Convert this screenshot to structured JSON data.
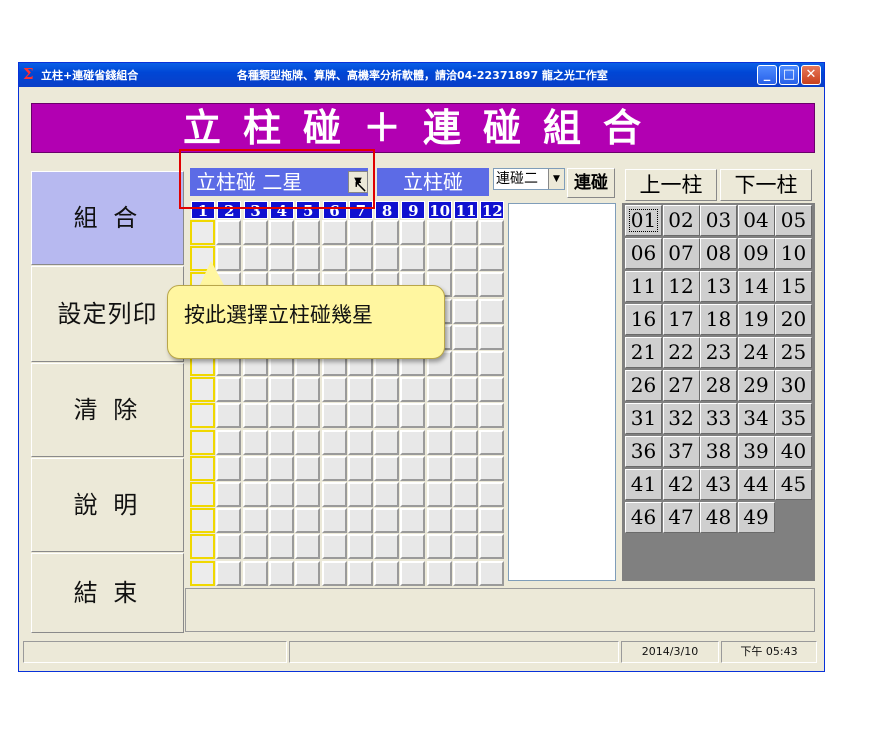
{
  "window": {
    "title": "立柱+連碰省錢組合",
    "subtitle": "各種類型拖牌、算牌、高機率分析軟體，請洽04-22371897 龍之光工作室",
    "minimize_icon": "minimize-icon",
    "maximize_icon": "maximize-icon",
    "close_icon": "close-icon"
  },
  "banner": {
    "title": "立柱碰＋連碰組合"
  },
  "sidebar": {
    "items": [
      {
        "label": "組 合"
      },
      {
        "label": "設定列印"
      },
      {
        "label": "清 除"
      },
      {
        "label": "說 明"
      },
      {
        "label": "結 束"
      }
    ]
  },
  "controls": {
    "star_select": "立柱碰  二星",
    "mode_label": "立柱碰",
    "connect_select": "連碰二",
    "connect_button": "連碰"
  },
  "grid": {
    "columns": [
      "1",
      "2",
      "3",
      "4",
      "5",
      "6",
      "7",
      "8",
      "9",
      "10",
      "11",
      "12"
    ],
    "rows": 14
  },
  "nav": {
    "prev": "上一柱",
    "next": "下一柱"
  },
  "numbers": [
    "01",
    "02",
    "03",
    "04",
    "05",
    "06",
    "07",
    "08",
    "09",
    "10",
    "11",
    "12",
    "13",
    "14",
    "15",
    "16",
    "17",
    "18",
    "19",
    "20",
    "21",
    "22",
    "23",
    "24",
    "25",
    "26",
    "27",
    "28",
    "29",
    "30",
    "31",
    "32",
    "33",
    "34",
    "35",
    "36",
    "37",
    "38",
    "39",
    "40",
    "41",
    "42",
    "43",
    "44",
    "45",
    "46",
    "47",
    "48",
    "49"
  ],
  "selected_number": "01",
  "callout": {
    "text": "按此選擇立柱碰幾星"
  },
  "status": {
    "date": "2014/3/10",
    "time": "下午 05:43"
  },
  "colors": {
    "banner": "#b200b2",
    "header_blue": "#1010d0",
    "select_blue": "#5c6be6",
    "callout": "#fff6a0"
  }
}
